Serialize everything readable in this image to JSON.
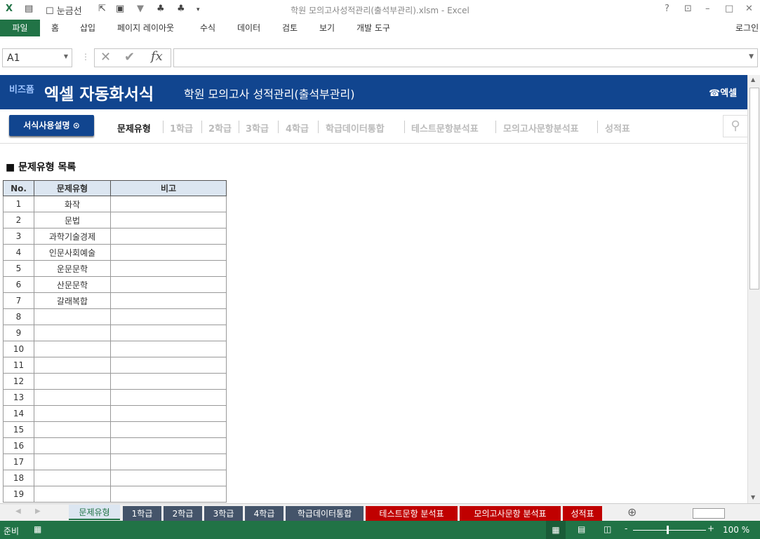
{
  "titlebar": {
    "title": "학원 모의고사성적관리(출석부관리).xlsm - Excel",
    "gridlines_label": "눈금선",
    "help": "?",
    "login": "로그인"
  },
  "ribbon": {
    "tabs": [
      "파일",
      "홈",
      "삽입",
      "페이지 레이아웃",
      "수식",
      "데이터",
      "검토",
      "보기",
      "개발 도구"
    ]
  },
  "formula": {
    "namebox": "A1",
    "fx": "fx",
    "value": ""
  },
  "banner": {
    "brand_small": "비즈폼",
    "brand": "엑셀 자동화서식",
    "title": "학원 모의고사 성적관리(출석부관리)",
    "phone": "엑셀"
  },
  "nav": {
    "guide_button": "서식사용설명",
    "links": [
      "문제유형",
      "1학급",
      "2학급",
      "3학급",
      "4학급",
      "학급데이터통합",
      "테스트문항분석표",
      "모의고사문항분석표",
      "성적표"
    ]
  },
  "section": {
    "heading": "■ 문제유형 목록"
  },
  "table": {
    "headers": [
      "No.",
      "문제유형",
      "비고"
    ],
    "rows": [
      [
        "1",
        "화작",
        ""
      ],
      [
        "2",
        "문법",
        ""
      ],
      [
        "3",
        "과학기술경제",
        ""
      ],
      [
        "4",
        "인문사회예술",
        ""
      ],
      [
        "5",
        "운문문학",
        ""
      ],
      [
        "6",
        "산문문학",
        ""
      ],
      [
        "7",
        "갈래복합",
        ""
      ],
      [
        "8",
        "",
        ""
      ],
      [
        "9",
        "",
        ""
      ],
      [
        "10",
        "",
        ""
      ],
      [
        "11",
        "",
        ""
      ],
      [
        "12",
        "",
        ""
      ],
      [
        "13",
        "",
        ""
      ],
      [
        "14",
        "",
        ""
      ],
      [
        "15",
        "",
        ""
      ],
      [
        "16",
        "",
        ""
      ],
      [
        "17",
        "",
        ""
      ],
      [
        "18",
        "",
        ""
      ],
      [
        "19",
        "",
        ""
      ]
    ]
  },
  "sheet_tabs": [
    {
      "label": "문제유형",
      "color": "#dce6f1",
      "active": true
    },
    {
      "label": "1학급",
      "color": "#44546a"
    },
    {
      "label": "2학급",
      "color": "#44546a"
    },
    {
      "label": "3학급",
      "color": "#44546a"
    },
    {
      "label": "4학급",
      "color": "#44546a"
    },
    {
      "label": "학급데이터통합",
      "color": "#44546a"
    },
    {
      "label": "테스트문항 분석표",
      "color": "#c00000"
    },
    {
      "label": "모의고사문항 분석표",
      "color": "#c00000"
    },
    {
      "label": "성적표",
      "color": "#c00000"
    }
  ],
  "status": {
    "ready": "준비",
    "zoom": "100 %"
  }
}
